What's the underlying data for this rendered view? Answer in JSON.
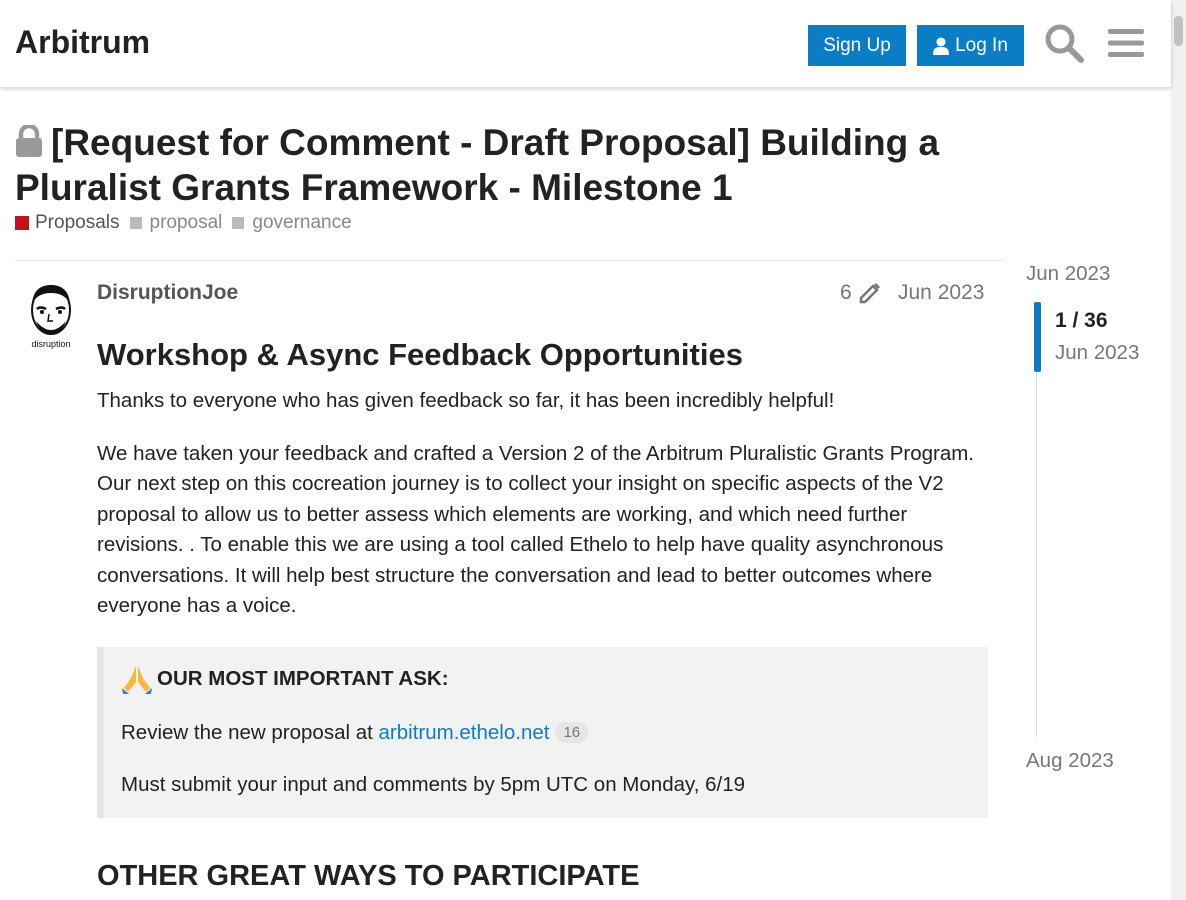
{
  "header": {
    "site_title": "Arbitrum",
    "signup_label": "Sign Up",
    "login_label": "Log In"
  },
  "topic": {
    "title": "[Request for Comment - Draft Proposal] Building a Pluralist Grants Framework - Milestone 1",
    "category": "Proposals",
    "tags": [
      "proposal",
      "governance"
    ]
  },
  "post": {
    "username": "DisruptionJoe",
    "edit_count": "6",
    "date": "Jun 2023",
    "heading": "Workshop & Async Feedback Opportunities",
    "paragraphs": [
      "Thanks to everyone who has given feedback so far, it has been incredibly helpful!",
      "We have taken your feedback and crafted a Version 2 of the Arbitrum Pluralistic Grants Program. Our next step on this cocreation journey is to collect your insight on specific aspects of the V2 proposal to allow us to better assess which elements are working, and which need further revisions. . To enable this we are using a tool called Ethelo to help have quality asynchronous conversations. It will help best structure the conversation and lead to better outcomes where everyone has a voice."
    ],
    "callout": {
      "heading": "OUR MOST IMPORTANT ASK:",
      "review_prefix": "Review the new proposal at ",
      "link_text": "arbitrum.ethelo.net",
      "link_clicks": "16",
      "deadline": "Must submit your input and comments by 5pm UTC on Monday, 6/19"
    },
    "section_heading": "OTHER GREAT WAYS TO PARTICIPATE"
  },
  "timeline": {
    "start_date": "Jun 2023",
    "position": "1 / 36",
    "current_date": "Jun 2023",
    "end_date": "Aug 2023"
  },
  "colors": {
    "accent": "#0a7ec5",
    "category": "#c1121f"
  }
}
